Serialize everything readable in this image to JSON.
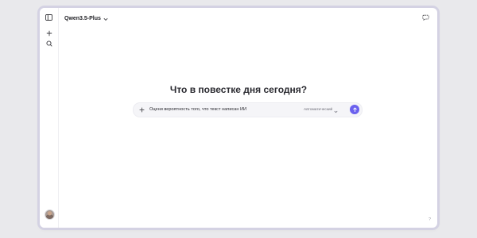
{
  "header": {
    "model_name": "Qwen3.5-Plus"
  },
  "sidebar": {
    "icons": [
      "sidebar-toggle-icon",
      "plus-icon",
      "search-icon"
    ]
  },
  "main": {
    "heading": "Что в повестке дня сегодня?",
    "composer": {
      "prompt": "Оцени вероятность того, что текст написан ИИ",
      "mode_label": "Автоматический"
    }
  },
  "colors": {
    "accent": "#6b61ee",
    "background": "#e9e9ec",
    "window": "#ffffff"
  },
  "footer": {
    "help_glyph": "?"
  }
}
